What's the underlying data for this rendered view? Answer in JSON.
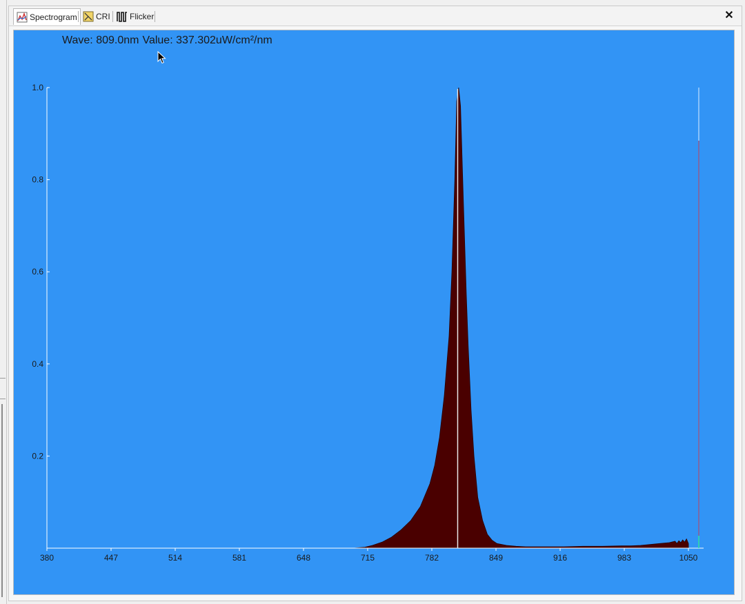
{
  "tabs": [
    {
      "label": "Spectrogram",
      "icon": "spectrogram-icon",
      "active": true
    },
    {
      "label": "CRI",
      "icon": "cri-icon",
      "active": false
    },
    {
      "label": "Flicker",
      "icon": "flicker-icon",
      "active": false
    }
  ],
  "close_label": "✕",
  "readout": {
    "wave": "Wave: 809.0nm",
    "value": "Value: 337.302uW/cm²/nm"
  },
  "colors": {
    "plot_bg": "#3294f5",
    "fill": "#4a0000",
    "axis": "#ffffff",
    "cursor_line": "#e8e8e8"
  },
  "chart_data": {
    "type": "area",
    "title": "",
    "xlabel": "",
    "ylabel": "",
    "xlim": [
      380,
      1050
    ],
    "ylim": [
      0,
      1.0
    ],
    "x_ticks": [
      "380",
      "447",
      "514",
      "581",
      "648",
      "715",
      "782",
      "849",
      "916",
      "983",
      "1050"
    ],
    "y_ticks": [
      "0.2",
      "0.4",
      "0.6",
      "0.8",
      "1.0"
    ],
    "cursor_x": 809,
    "series": [
      {
        "x": [
          380,
          500,
          600,
          700,
          712,
          720,
          730,
          740,
          750,
          760,
          770,
          780,
          785,
          790,
          795,
          800,
          803,
          806,
          808,
          810,
          812,
          815,
          818,
          820,
          823,
          826,
          830,
          835,
          840,
          845,
          850,
          860,
          870,
          880,
          900,
          920,
          940,
          960,
          980,
          990,
          1000,
          1010,
          1020,
          1030,
          1036,
          1038,
          1040,
          1042,
          1044,
          1046,
          1048,
          1050
        ],
        "y": [
          0,
          0,
          0,
          0,
          0.002,
          0.006,
          0.013,
          0.024,
          0.04,
          0.06,
          0.09,
          0.14,
          0.18,
          0.24,
          0.33,
          0.46,
          0.6,
          0.8,
          0.97,
          1.0,
          0.96,
          0.75,
          0.55,
          0.44,
          0.3,
          0.2,
          0.11,
          0.06,
          0.03,
          0.017,
          0.01,
          0.006,
          0.004,
          0.003,
          0.003,
          0.003,
          0.004,
          0.004,
          0.005,
          0.005,
          0.006,
          0.008,
          0.01,
          0.012,
          0.015,
          0.01,
          0.016,
          0.012,
          0.018,
          0.013,
          0.02,
          0.01
        ]
      }
    ]
  }
}
